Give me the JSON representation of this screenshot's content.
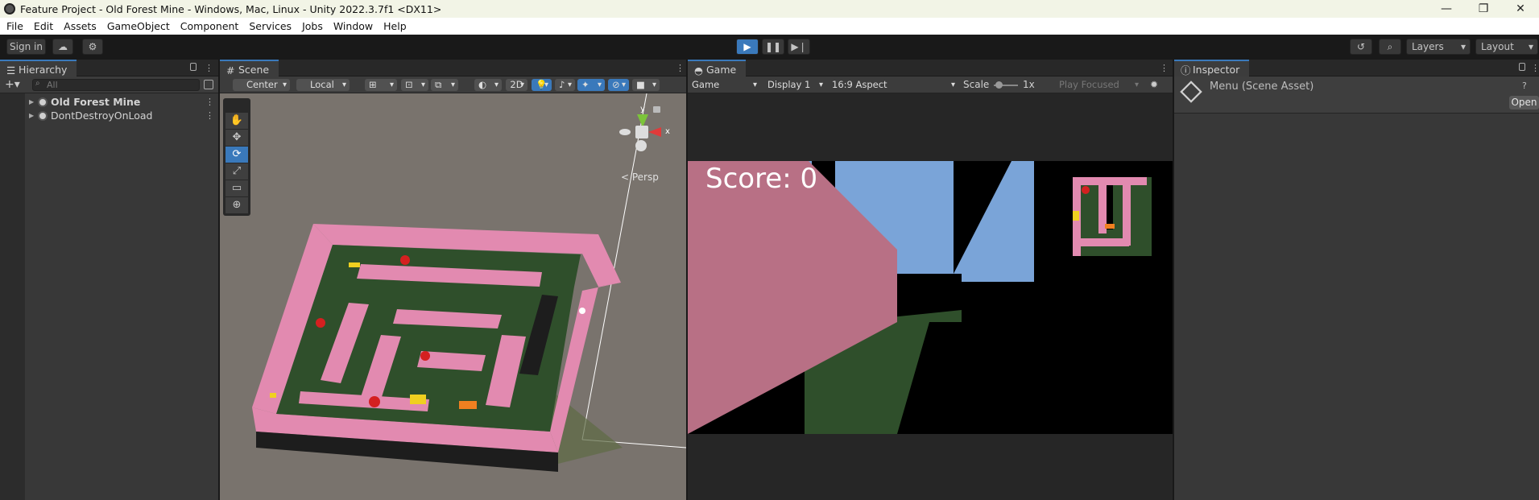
{
  "window": {
    "title": "Feature Project - Old Forest Mine - Windows, Mac, Linux - Unity 2022.3.7f1 <DX11>",
    "controls": [
      "—",
      "❐",
      "✕"
    ]
  },
  "menu": [
    "File",
    "Edit",
    "Assets",
    "GameObject",
    "Component",
    "Services",
    "Jobs",
    "Window",
    "Help"
  ],
  "toolbar": {
    "sign_in": "Sign in",
    "layers": "Layers",
    "layout": "Layout"
  },
  "hierarchy": {
    "tab": "Hierarchy",
    "search_placeholder": "All",
    "items": [
      {
        "label": "Old Forest Mine",
        "bold": true
      },
      {
        "label": "DontDestroyOnLoad",
        "bold": false
      }
    ]
  },
  "scene": {
    "tab": "Scene",
    "pivot": "Center",
    "space": "Local",
    "mode_2d": "2D",
    "gizmo_persp": "< Persp",
    "axis_y": "y",
    "axis_x": "x"
  },
  "game": {
    "tab": "Game",
    "view": "Game",
    "display": "Display 1",
    "aspect": "16:9 Aspect",
    "scale_label": "Scale",
    "scale_value": "1x",
    "play_mode": "Play Focused",
    "score_text": "Score: 0"
  },
  "inspector": {
    "tab": "Inspector",
    "asset": "Menu (Scene Asset)",
    "open_button": "Open"
  },
  "colors": {
    "accent": "#3a79bb",
    "wall_pink": "#e28ab0",
    "floor_green": "#2f4f2b",
    "sky": "#7aa4d8"
  }
}
